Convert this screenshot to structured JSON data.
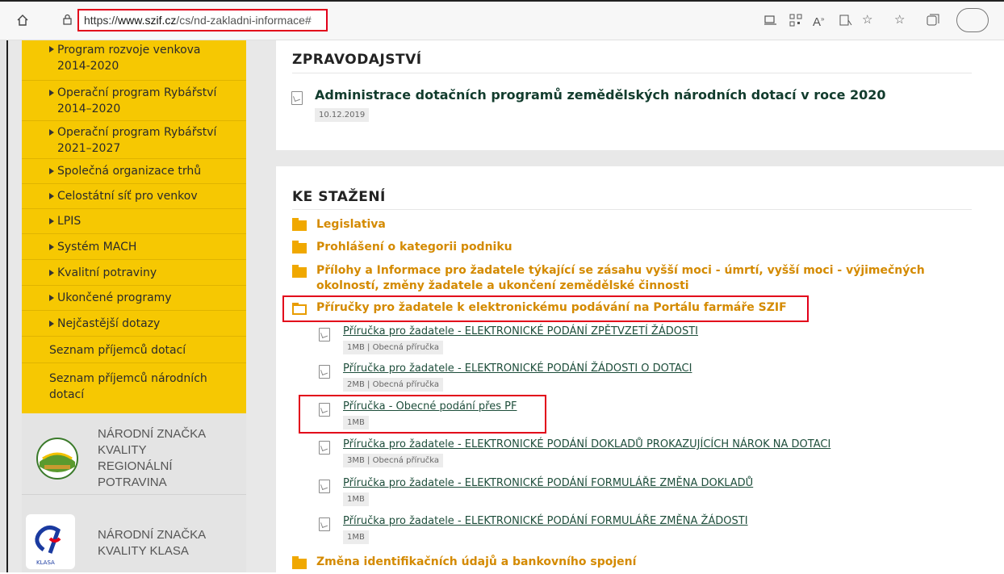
{
  "browser": {
    "url_proto": "https://",
    "url_host": "www.szif.cz",
    "url_path": "/cs/nd-zakladni-informace#",
    "icons": [
      "home-icon",
      "lock-icon",
      "app-available-icon",
      "qr-icon",
      "read-aloud-icon",
      "immersive-reader-icon",
      "favorite-add-icon",
      "favorites-icon",
      "collections-icon",
      "profile-icon"
    ]
  },
  "sidebar": {
    "items": [
      {
        "label": "Program rozvoje venkova 2014-2020"
      },
      {
        "label": "Operační program Rybářství 2014–2020"
      },
      {
        "label": "Operační program Rybářství 2021–2027"
      },
      {
        "label": "Společná organizace trhů"
      },
      {
        "label": "Celostátní síť pro venkov"
      },
      {
        "label": "LPIS"
      },
      {
        "label": "Systém MACH"
      },
      {
        "label": "Kvalitní potraviny"
      },
      {
        "label": "Ukončené programy"
      },
      {
        "label": "Nejčastější dotazy"
      },
      {
        "label": "Seznam příjemců dotací"
      },
      {
        "label": "Seznam příjemců národních dotací"
      }
    ]
  },
  "brands": [
    {
      "line1": "NÁRODNÍ ZNAČKA",
      "line2": "KVALITY",
      "line3": "REGIONÁLNÍ",
      "line4": "POTRAVINA"
    },
    {
      "line1": "NÁRODNÍ ZNAČKA",
      "line2": "KVALITY KLASA",
      "logo_text": "KLASA"
    }
  ],
  "news": {
    "heading": "ZPRAVODAJSTVÍ",
    "items": [
      {
        "title": "Administrace dotačních programů zemědělských národních dotací v roce 2020",
        "date": "10.12.2019"
      }
    ]
  },
  "downloads": {
    "heading": "KE STAŽENÍ",
    "categories": [
      {
        "label": "Legislativa"
      },
      {
        "label": "Prohlášení o kategorii podniku"
      },
      {
        "label": "Přílohy a Informace pro žadatele týkající se zásahu vyšší moci - úmrtí, vyšší moci - výjimečných okolností, změny žadatele a ukončení zemědělské činnosti"
      },
      {
        "label": "Příručky pro žadatele k elektronickému podávání na Portálu farmáře SZIF"
      },
      {
        "label": "Změna identifikačních údajů a bankovního spojení"
      }
    ],
    "files": [
      {
        "title": "Příručka pro žadatele - ELEKTRONICKÉ PODÁNÍ ZPĚTVZETÍ ŽÁDOSTI",
        "meta": "1MB | Obecná příručka"
      },
      {
        "title": "Příručka pro žadatele - ELEKTRONICKÉ PODÁNÍ ŽÁDOSTI O DOTACI",
        "meta": "2MB | Obecná příručka"
      },
      {
        "title": "Příručka - Obecné podání přes PF",
        "meta": "1MB"
      },
      {
        "title": "Příručka pro žadatele - ELEKTRONICKÉ PODÁNÍ DOKLADŮ PROKAZUJÍCÍCH NÁROK NA DOTACI",
        "meta": "3MB | Obecná příručka"
      },
      {
        "title": "Příručka pro žadatele - ELEKTRONICKÉ PODÁNÍ FORMULÁŘE ZMĚNA DOKLADŮ",
        "meta": "1MB"
      },
      {
        "title": "Příručka pro žadatele - ELEKTRONICKÉ PODÁNÍ FORMULÁŘE ZMĚNA ŽÁDOSTI",
        "meta": "1MB"
      }
    ]
  },
  "colors": {
    "sidebar_bg": "#f6c802",
    "category_orange": "#d48a00",
    "link_green": "#1e4e3b",
    "highlight_red": "#e2001a"
  }
}
